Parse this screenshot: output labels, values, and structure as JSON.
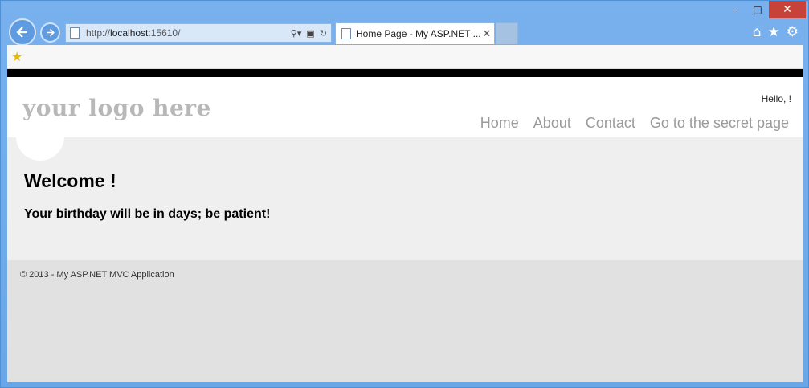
{
  "browser": {
    "address": {
      "prefix": "http://",
      "host": "localhost",
      "port": ":15610/"
    },
    "tab_title": "Home Page - My ASP.NET ...",
    "window_controls": {
      "minimize": "–",
      "maximize": "□",
      "close": "✕"
    }
  },
  "page": {
    "logo": "your logo here",
    "greeting": "Hello, !",
    "menu": [
      {
        "label": "Home"
      },
      {
        "label": "About"
      },
      {
        "label": "Contact"
      },
      {
        "label": "Go to the secret page"
      }
    ],
    "welcome": "Welcome !",
    "birthday": "Your birthday will be in days; be patient!",
    "footer": "© 2013 - My ASP.NET MVC Application"
  },
  "icons": [
    "back-icon",
    "forward-icon",
    "page-icon",
    "search-icon",
    "compat-icon",
    "refresh-icon",
    "home-icon",
    "favorites-icon",
    "settings-icon",
    "add-favorite-icon"
  ]
}
